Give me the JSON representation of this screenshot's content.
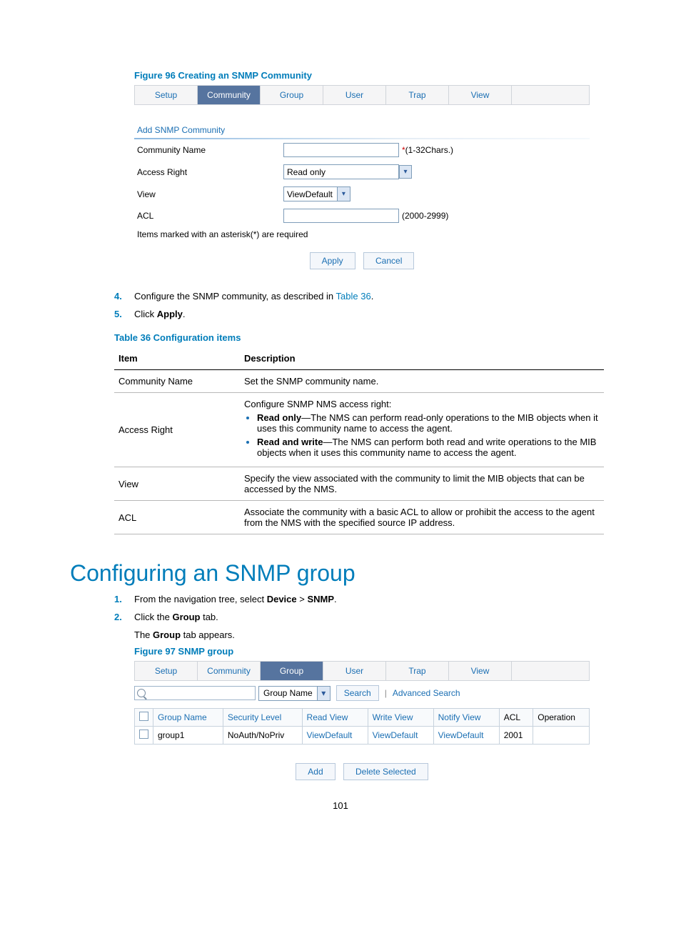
{
  "figure96": {
    "caption": "Figure 96 Creating an SNMP Community",
    "tabs": [
      "Setup",
      "Community",
      "Group",
      "User",
      "Trap",
      "View"
    ],
    "active_tab": 1,
    "section_title": "Add SNMP Community",
    "rows": {
      "community_name_label": "Community Name",
      "community_name_hint": "*(1-32Chars.)",
      "access_right_label": "Access Right",
      "access_right_value": "Read only",
      "view_label": "View",
      "view_value": "ViewDefault",
      "acl_label": "ACL",
      "acl_hint": "(2000-2999)"
    },
    "required_note": "Items marked with an asterisk(*) are required",
    "apply_btn": "Apply",
    "cancel_btn": "Cancel"
  },
  "steps_a": [
    {
      "num": "4.",
      "text_pre": "Configure the SNMP community, as described in ",
      "link": "Table 36",
      "text_post": "."
    },
    {
      "num": "5.",
      "text_pre": "Click ",
      "bold": "Apply",
      "text_post": "."
    }
  ],
  "table36": {
    "caption": "Table 36 Configuration items",
    "header_item": "Item",
    "header_desc": "Description",
    "rows": [
      {
        "item": "Community Name",
        "desc": "Set the SNMP community name."
      },
      {
        "item": "Access Right",
        "desc_intro": "Configure SNMP NMS access right:",
        "bullets": [
          {
            "b": "Read only",
            "rest": "—The NMS can perform read-only operations to the MIB objects when it uses this community name to access the agent."
          },
          {
            "b": "Read and write",
            "rest": "—The NMS can perform both read and write operations to the MIB objects when it uses this community name to access the agent."
          }
        ]
      },
      {
        "item": "View",
        "desc": "Specify the view associated with the community to limit the MIB objects that can be accessed by the NMS."
      },
      {
        "item": "ACL",
        "desc": "Associate the community with a basic ACL to allow or prohibit the access to the agent from the NMS with the specified source IP address."
      }
    ]
  },
  "h2": "Configuring an SNMP group",
  "steps_b": [
    {
      "num": "1.",
      "text_pre": "From the navigation tree, select ",
      "bold": "Device",
      "mid": " > ",
      "bold2": "SNMP",
      "text_post": "."
    },
    {
      "num": "2.",
      "text_pre": "Click the ",
      "bold": "Group",
      "text_post": " tab."
    }
  ],
  "step2_followup_pre": "The ",
  "step2_followup_bold": "Group",
  "step2_followup_post": " tab appears.",
  "figure97": {
    "caption": "Figure 97 SNMP group",
    "tabs": [
      "Setup",
      "Community",
      "Group",
      "User",
      "Trap",
      "View"
    ],
    "active_tab": 2,
    "search_field_label": "Group Name",
    "search_btn": "Search",
    "adv_search": "Advanced Search",
    "headers": [
      "",
      "Group Name",
      "Security Level",
      "Read View",
      "Write View",
      "Notify View",
      "ACL",
      "Operation"
    ],
    "row": {
      "name": "group1",
      "sec": "NoAuth/NoPriv",
      "rv": "ViewDefault",
      "wv": "ViewDefault",
      "nv": "ViewDefault",
      "acl": "2001"
    },
    "add_btn": "Add",
    "del_btn": "Delete Selected"
  },
  "page_number": "101",
  "divider": "|"
}
